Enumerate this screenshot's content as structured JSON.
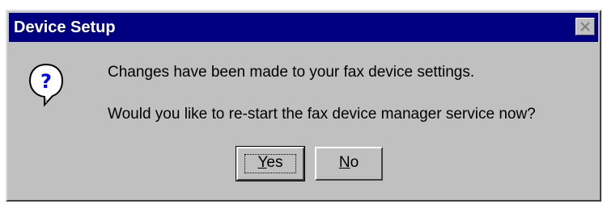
{
  "window": {
    "title": "Device Setup",
    "close_icon": "close-icon"
  },
  "message": {
    "icon": "question-icon",
    "line1": "Changes have been made to your fax device settings.",
    "line2": "Would you like to re-start the fax device manager service now?"
  },
  "buttons": {
    "yes": {
      "mnemonic": "Y",
      "rest": "es"
    },
    "no": {
      "mnemonic": "N",
      "rest": "o"
    }
  },
  "colors": {
    "titlebar": "#000080",
    "dialog_face": "#c0c0c0"
  }
}
